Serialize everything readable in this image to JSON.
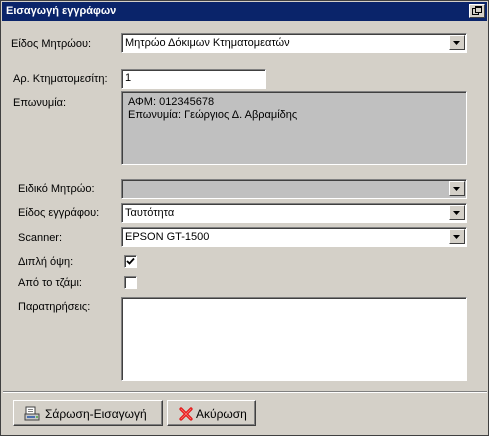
{
  "window": {
    "title": "Εισαγωγή εγγράφων",
    "restore_icon": "restore-window-icon"
  },
  "form": {
    "registry_type": {
      "label": "Είδος Μητρώου:",
      "value": "Μητρώο Δόκιμων Κτηματομεατών"
    },
    "surveyor_no": {
      "label": "Αρ. Κτηματομεσίτη:",
      "value": "1"
    },
    "name": {
      "label": "Επωνυμία:",
      "lines": [
        "ΑΦΜ: 012345678",
        "Επωνυμία: Γεώργιος Δ. Αβραμίδης"
      ]
    },
    "special_registry": {
      "label": "Ειδικό Μητρώο:",
      "value": ""
    },
    "document_type": {
      "label": "Είδος εγγράφου:",
      "value": "Ταυτότητα"
    },
    "scanner": {
      "label": "Scanner:",
      "value": "EPSON GT-1500"
    },
    "duplex": {
      "label": "Διπλή όψη:",
      "checked": true
    },
    "from_glass": {
      "label": "Από το τζάμι:",
      "checked": false
    },
    "notes": {
      "label": "Παρατηρήσεις:",
      "value": ""
    }
  },
  "buttons": {
    "scan_insert": {
      "label": "Σάρωση-Εισαγωγή",
      "icon": "scanner-icon"
    },
    "cancel": {
      "label": "Ακύρωση",
      "icon": "red-x-icon"
    }
  },
  "colors": {
    "titlebar": "#0a246a",
    "window_face": "#d4d0c8",
    "disabled_field": "#c0c0c0",
    "cancel_icon": "#e01010"
  }
}
